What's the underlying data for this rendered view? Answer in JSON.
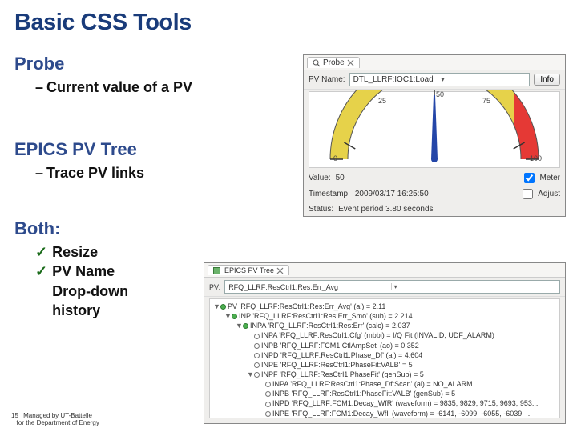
{
  "title": "Basic CSS Tools",
  "sections": {
    "probe": {
      "heading": "Probe",
      "sub": "Current value of a PV"
    },
    "tree": {
      "heading": "EPICS PV Tree",
      "sub": "Trace PV links"
    },
    "both": {
      "heading": "Both:",
      "items": [
        "Resize",
        "PV Name Drop-down history"
      ]
    }
  },
  "probe_panel": {
    "tab_label": "Probe",
    "pvname_label": "PV Name:",
    "pvname_value": "DTL_LLRF:IOC1:Load",
    "info_btn": "Info",
    "ticks": {
      "t0": "0",
      "t25": "25",
      "t50": "50",
      "t75": "75",
      "t100": "100"
    },
    "value_label": "Value:",
    "value_value": "50",
    "meter_label": "Meter",
    "ts_label": "Timestamp:",
    "ts_value": "2009/03/17 16:25:50",
    "adjust_label": "Adjust",
    "status_label": "Status:",
    "status_value": "Event period 3.80 seconds"
  },
  "tree_panel": {
    "tab_label": "EPICS PV Tree",
    "pv_label": "PV:",
    "pv_value": "RFQ_LLRF:ResCtrl1:Res:Err_Avg",
    "nodes": [
      {
        "indent": 0,
        "tw": "▼",
        "text": "PV 'RFQ_LLRF:ResCtrl1:Res:Err_Avg'  (ai)  =  2.11"
      },
      {
        "indent": 1,
        "tw": "▼",
        "text": "INP 'RFQ_LLRF:ResCtrl1:Res:Err_Smo'  (sub)  =  2.214"
      },
      {
        "indent": 2,
        "tw": "▼",
        "text": "INPA 'RFQ_LLRF:ResCtrl1:Res:Err'  (calc)  =  2.037"
      },
      {
        "indent": 3,
        "tw": "",
        "text": "INPA 'RFQ_LLRF:ResCtrl1:Cfg'  (mbbi)  =  I/Q Fit (INVALID, UDF_ALARM)"
      },
      {
        "indent": 3,
        "tw": "",
        "text": "INPB 'RFQ_LLRF:FCM1:CtlAmpSet'  (ao)  =  0.352"
      },
      {
        "indent": 3,
        "tw": "",
        "text": "INPD 'RFQ_LLRF:ResCtrl1:Phase_Df'  (ai)  =  4.604"
      },
      {
        "indent": 3,
        "tw": "",
        "text": "INPE 'RFQ_LLRF:ResCtrl1:PhaseFit:VALB'  =  5"
      },
      {
        "indent": 3,
        "tw": "▼",
        "text": "INPF 'RFQ_LLRF:ResCtrl1:PhaseFit'  (genSub)  =  5"
      },
      {
        "indent": 4,
        "tw": "",
        "text": "INPA 'RFQ_LLRF:ResCtrl1:Phase_Df:Scan'  (ai)  =  NO_ALARM"
      },
      {
        "indent": 4,
        "tw": "",
        "text": "INPB 'RFQ_LLRF:ResCtrl1:PhaseFit:VALB'  (genSub)  =  5"
      },
      {
        "indent": 4,
        "tw": "",
        "text": "INPD 'RFQ_LLRF:FCM1:Decay_WfR'  (waveform)  =  9835, 9829, 9715, 9693, 953..."
      },
      {
        "indent": 4,
        "tw": "",
        "text": "INPE 'RFQ_LLRF:FCM1:Decay_WfI'  (waveform)  =  -6141, -6099, -6055, -6039, ..."
      }
    ]
  },
  "footer": {
    "page": "15",
    "line1": "Managed by UT-Battelle",
    "line2": "for the Department of Energy"
  }
}
